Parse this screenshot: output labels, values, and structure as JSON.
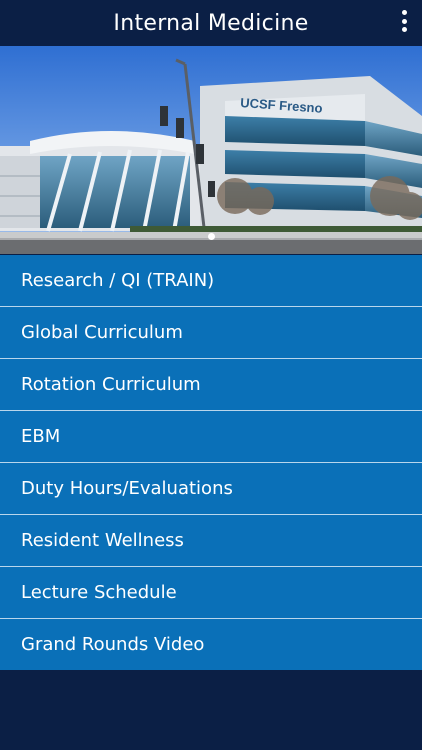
{
  "header": {
    "title": "Internal Medicine",
    "menu_icon": "vertical-ellipsis-icon"
  },
  "banner": {
    "building_sign": "UCSF Fresno",
    "pager": {
      "count": 1,
      "active_index": 0
    }
  },
  "menu": {
    "items": [
      {
        "label": "Research / QI (TRAIN)"
      },
      {
        "label": "Global Curriculum"
      },
      {
        "label": "Rotation Curriculum"
      },
      {
        "label": "EBM"
      },
      {
        "label": "Duty Hours/Evaluations"
      },
      {
        "label": "Resident Wellness"
      },
      {
        "label": "Lecture Schedule"
      },
      {
        "label": "Grand Rounds Video"
      }
    ]
  },
  "colors": {
    "header_bg": "#0b1f45",
    "menu_item_bg": "#0a70b8",
    "divider": "#b9d6ec",
    "text": "#ffffff"
  }
}
